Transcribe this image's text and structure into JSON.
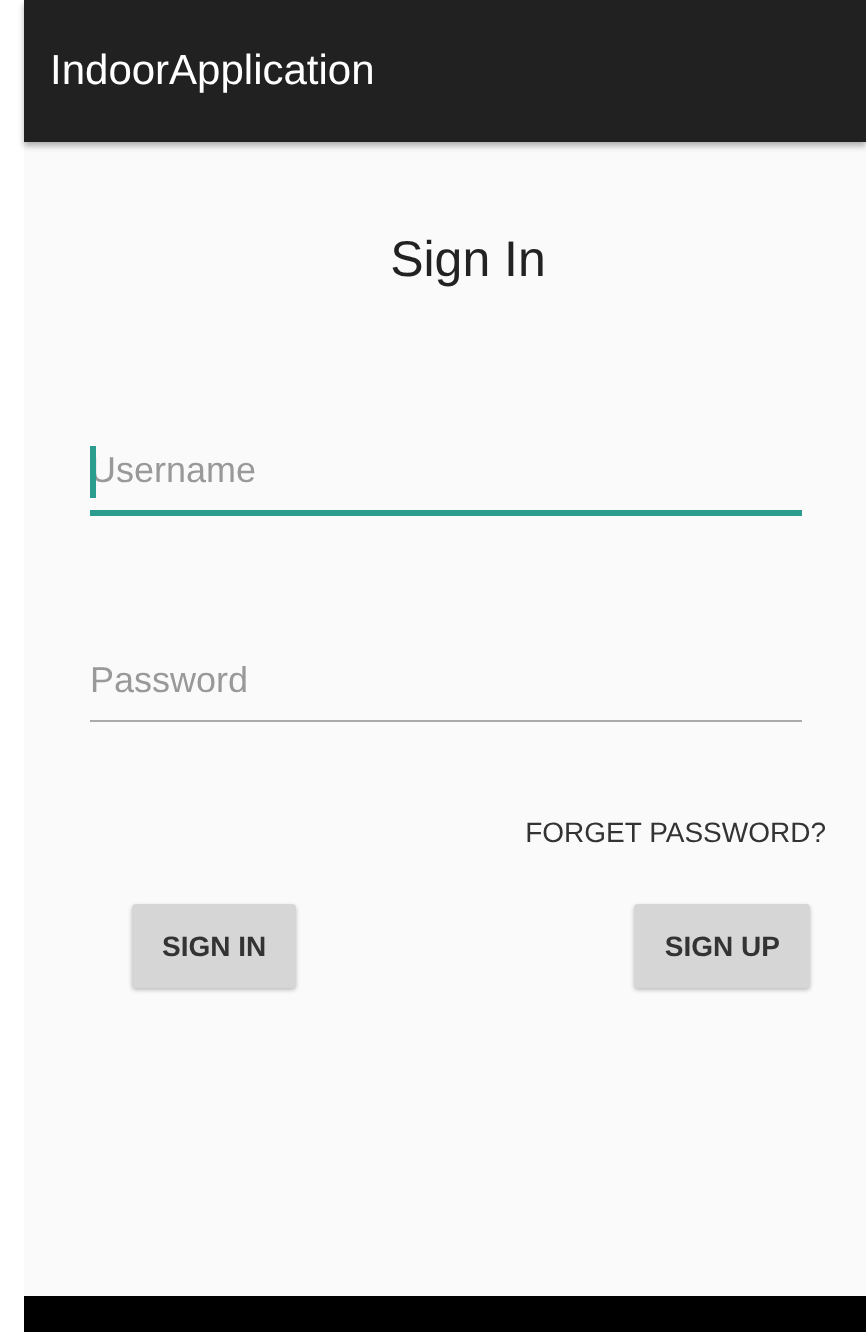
{
  "app_bar": {
    "title": "IndoorApplication"
  },
  "heading": "Sign In",
  "fields": [
    {
      "placeholder": "Username",
      "focused": true
    },
    {
      "placeholder": "Password",
      "focused": false
    }
  ],
  "link": "FORGET PASSWORD?",
  "buttons": [
    "SIGN IN",
    "SIGN UP"
  ]
}
